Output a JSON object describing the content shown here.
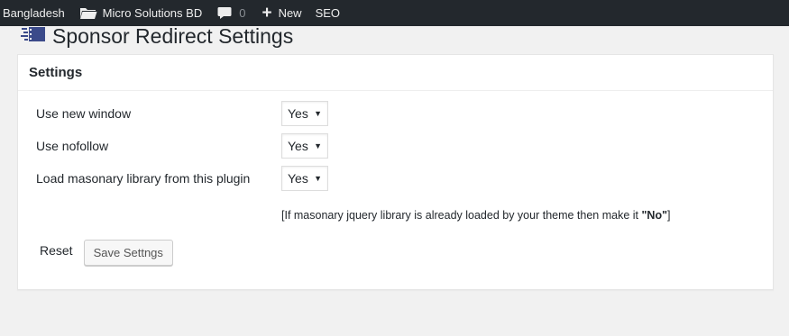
{
  "adminbar": {
    "site_name": "Bangladesh",
    "site_link": "Micro Solutions BD",
    "comment_count": "0",
    "new_label": "New",
    "seo_label": "SEO"
  },
  "page": {
    "title": "Sponsor Redirect Settings"
  },
  "settings": {
    "heading": "Settings",
    "fields": [
      {
        "label": "Use new window",
        "value": "Yes"
      },
      {
        "label": "Use nofollow",
        "value": "Yes"
      },
      {
        "label": "Load masonary library from this plugin",
        "value": "Yes"
      }
    ],
    "note_prefix": "[If masonary jquery library is already loaded by your theme then make it ",
    "note_bold": "\"No\"",
    "note_suffix": "]",
    "reset_label": "Reset",
    "save_label": "Save Settngs"
  },
  "colors": {
    "adminbar_bg": "#23282d",
    "page_bg": "#f1f1f1",
    "plugin_icon": "#3b4a8a"
  }
}
